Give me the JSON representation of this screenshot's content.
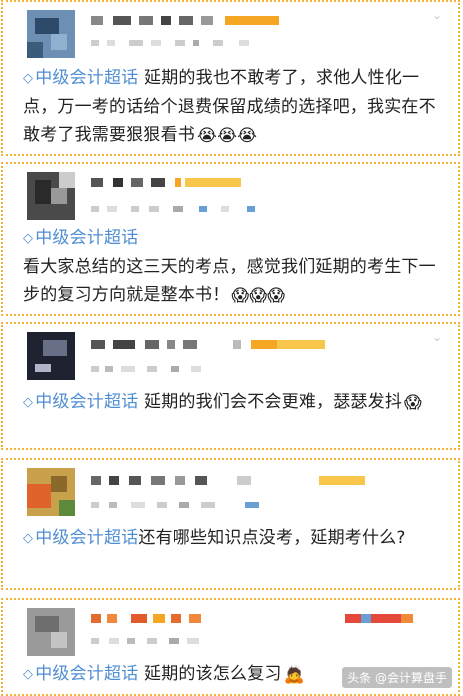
{
  "posts": [
    {
      "topic": "中级会计超话",
      "body": "延期的我也不敢考了，求他人性化一点，万一考的话给个退费保留成绩的选择吧，我实在不敢考了我需要狠狠看书",
      "emoji": "😭😭😭"
    },
    {
      "topic": "中级会计超话",
      "body": "看大家总结的这三天的考点，感觉我们延期的考生下一步的复习方向就是整本书！",
      "emoji": "😱😱😱"
    },
    {
      "topic": "中级会计超话",
      "body": "延期的我们会不会更难，瑟瑟发抖",
      "emoji": "😱"
    },
    {
      "topic": "中级会计超话",
      "body": "还有哪些知识点没考，延期考什么?",
      "emoji": ""
    },
    {
      "topic": "中级会计超话",
      "body": "延期的该怎么复习",
      "emoji": "🙇"
    }
  ],
  "watermark": "头条 @会计算盘手",
  "icons": {
    "topic": "diamond-topic-icon",
    "more": "chevron-down-icon"
  },
  "colors": {
    "topic": "#4f8ed3",
    "border": "#f2b335",
    "accent_orange": "#f5a623"
  }
}
